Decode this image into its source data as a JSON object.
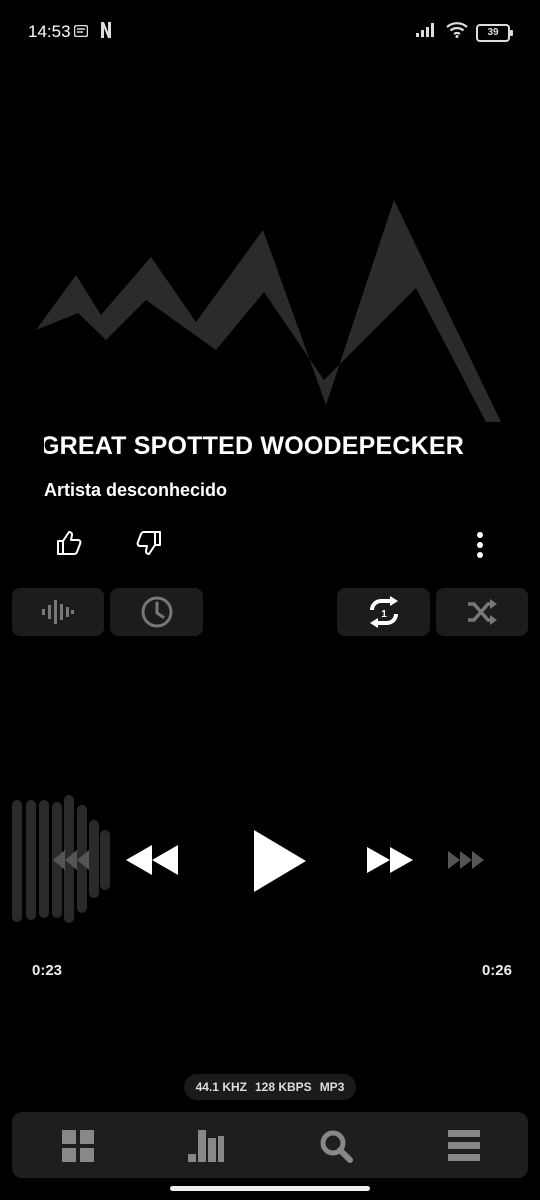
{
  "status_bar": {
    "time": "14:53",
    "battery": "39",
    "icons": [
      "notification-icon",
      "netflix-icon",
      "signal-icon",
      "wifi-icon",
      "battery-icon"
    ]
  },
  "track": {
    "title_lead": "",
    "title": "GREAT SPOTTED WOODEPECKER",
    "artist": "Artista desconhecido"
  },
  "playback": {
    "current_time": "0:23",
    "total_time": "0:26",
    "progress_fraction": 0.88
  },
  "quality": {
    "sample_rate": "44.1 KHZ",
    "bitrate": "128 KBPS",
    "format": "MP3"
  },
  "controls": {
    "tiles": [
      "equalizer-icon",
      "sleep-timer-icon",
      "repeat-one-icon",
      "shuffle-icon"
    ],
    "transport": [
      "rewind-far-icon",
      "rewind-icon",
      "play-icon",
      "fast-forward-icon",
      "fast-forward-far-icon"
    ]
  },
  "bottom_nav": [
    "grid-icon",
    "chart-icon",
    "search-icon",
    "menu-icon"
  ],
  "colors": {
    "background": "#000000",
    "tile": "#1c1c1c",
    "art": "#2b2b2b",
    "accent": "#ffffff"
  }
}
